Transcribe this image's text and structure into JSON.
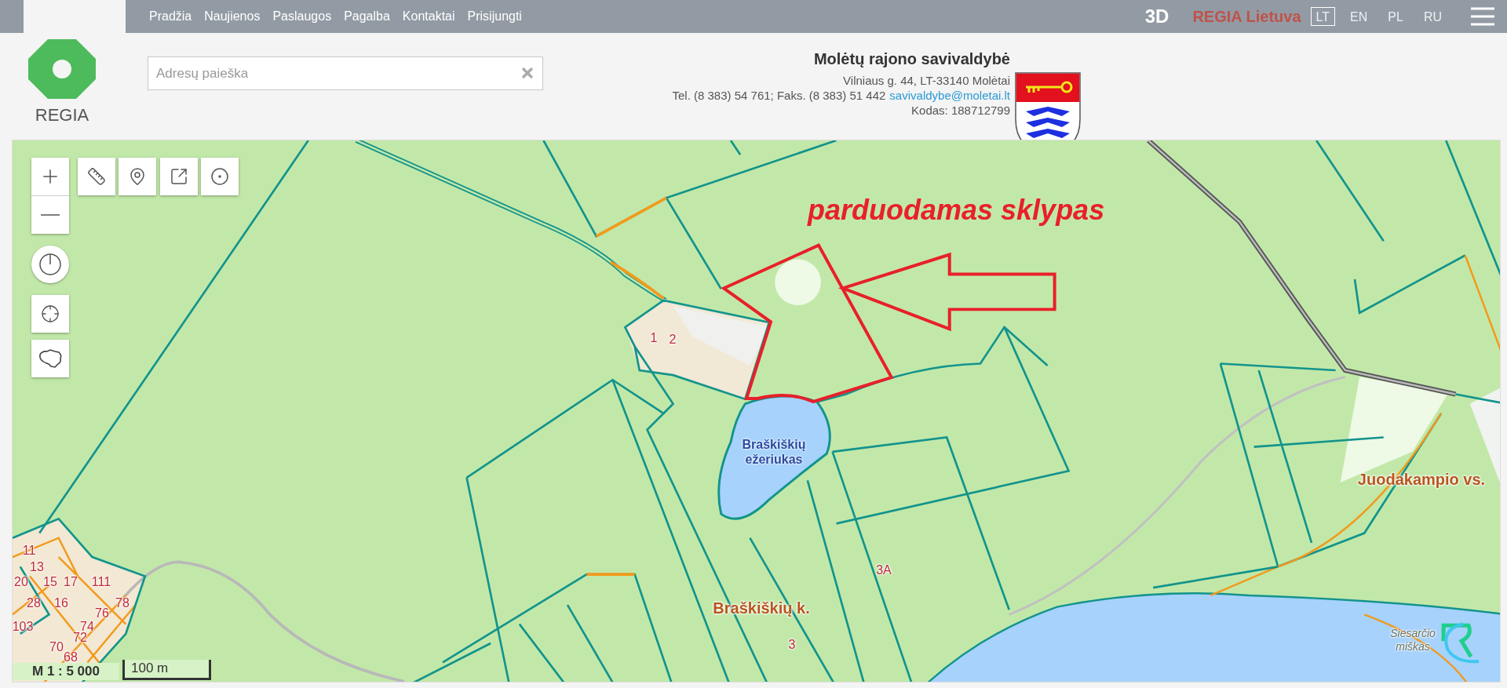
{
  "top_bar": {
    "logo_text": "REGIA",
    "nav": [
      "Pradžia",
      "Naujienos",
      "Paslaugos",
      "Pagalba",
      "Kontaktai",
      "Prisijungti"
    ],
    "view_3d": "3D",
    "brand": "REGIA Lietuva",
    "languages": [
      {
        "label": "LT",
        "selected": true
      },
      {
        "label": "EN",
        "selected": false
      },
      {
        "label": "PL",
        "selected": false
      },
      {
        "label": "RU",
        "selected": false
      }
    ]
  },
  "search": {
    "placeholder": "Adresų paieška"
  },
  "municipality": {
    "name": "Molėtų rajono savivaldybė",
    "address": "Vilniaus g. 44, LT-33140 Molėtai",
    "phone": "Tel. (8 383) 54 761; Faks. (8 383) 51 442",
    "email": "savivaldybe@moletai.lt",
    "code": "Kodas: 188712799"
  },
  "map": {
    "annotation": "parduodamas sklypas",
    "labels": [
      {
        "text": "1",
        "kind": "number"
      },
      {
        "text": "2",
        "kind": "number"
      },
      {
        "text": "Braškiškių ežeriukas",
        "kind": "lake"
      },
      {
        "text": "Juodakampio vs.",
        "kind": "village"
      },
      {
        "text": "11",
        "kind": "number"
      },
      {
        "text": "13",
        "kind": "number"
      },
      {
        "text": "3A",
        "kind": "number"
      },
      {
        "text": "20",
        "kind": "number"
      },
      {
        "text": "15",
        "kind": "number"
      },
      {
        "text": "17",
        "kind": "number"
      },
      {
        "text": "111",
        "kind": "number"
      },
      {
        "text": "28",
        "kind": "number"
      },
      {
        "text": "16",
        "kind": "number"
      },
      {
        "text": "78",
        "kind": "number"
      },
      {
        "text": "76",
        "kind": "number"
      },
      {
        "text": "Braškiškių k.",
        "kind": "village"
      },
      {
        "text": "103",
        "kind": "number"
      },
      {
        "text": "74",
        "kind": "number"
      },
      {
        "text": "72",
        "kind": "number"
      },
      {
        "text": "70",
        "kind": "number"
      },
      {
        "text": "3",
        "kind": "number"
      },
      {
        "text": "Siesarčio miškas",
        "kind": "forest"
      },
      {
        "text": "68",
        "kind": "number"
      }
    ],
    "scale": "M 1 : 5 000",
    "scale_bar": "100 m"
  }
}
